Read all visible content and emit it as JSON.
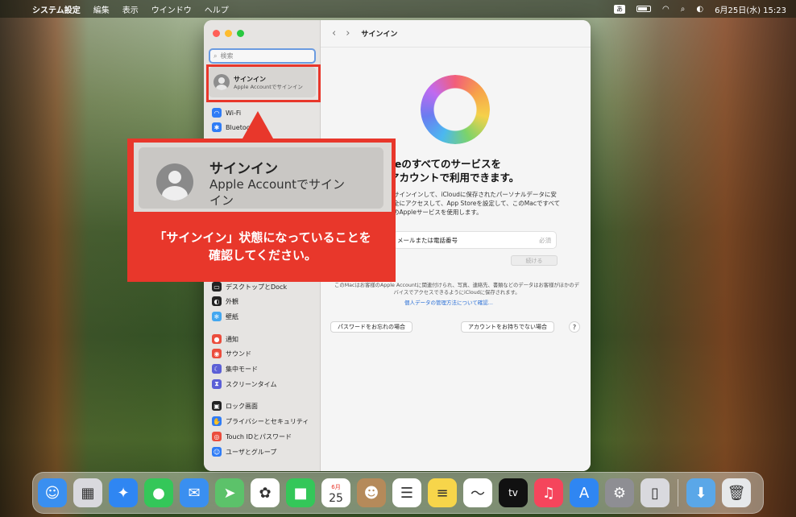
{
  "menubar": {
    "apple": "",
    "items": [
      "システム設定",
      "編集",
      "表示",
      "ウインドウ",
      "ヘルプ"
    ],
    "ime": "あ",
    "datetime": "6月25日(水)  15:23"
  },
  "window": {
    "search_placeholder": "検索",
    "signin_title": "サインイン",
    "signin_sub": "Apple Accountでサインイン",
    "sidebar_items": [
      {
        "label": "Wi-Fi",
        "icon": "wifi-icon",
        "color": "#2f7cf6"
      },
      {
        "label": "Bluetooth",
        "icon": "bluetooth-icon",
        "color": "#2f7cf6"
      },
      {
        "label": "デスクトップとDock",
        "icon": "dock-icon",
        "color": "#222222"
      },
      {
        "label": "外観",
        "icon": "appearance-icon",
        "color": "#222222"
      },
      {
        "label": "壁紙",
        "icon": "wallpaper-icon",
        "color": "#43a7f0"
      },
      {
        "label": "通知",
        "icon": "notification-icon",
        "color": "#eb4d3d"
      },
      {
        "label": "サウンド",
        "icon": "sound-icon",
        "color": "#eb4d3d"
      },
      {
        "label": "集中モード",
        "icon": "focus-icon",
        "color": "#5b5fd6"
      },
      {
        "label": "スクリーンタイム",
        "icon": "screentime-icon",
        "color": "#5b5fd6"
      },
      {
        "label": "ロック画面",
        "icon": "lock-icon",
        "color": "#222222"
      },
      {
        "label": "プライバシーとセキュリティ",
        "icon": "privacy-icon",
        "color": "#2f7cf6"
      },
      {
        "label": "Touch IDとパスワード",
        "icon": "touchid-icon",
        "color": "#eb4d3d"
      },
      {
        "label": "ユーザとグループ",
        "icon": "users-icon",
        "color": "#2f7cf6"
      }
    ],
    "toolbar_title": "サインイン",
    "headline": "Appleのすべてのサービスを\nこのアカウントで利用できます。",
    "description": "サインインして、iCloudに保存されたパーソナルデータに安全にアクセスして、App Storeを設定して、このMacですべてのAppleサービスを使用します。",
    "field_label": "メールまたは電話番号",
    "field_required": "必須",
    "continue": "続ける",
    "privacy_text": "このMacはお客様のApple Accountに関連付けられ、写真、連絡先、書類などのデータはお客様がほかのデバイスでアクセスできるようにiCloudに保存されます。",
    "privacy_link": "個人データの管理方法について確認...",
    "forgot_button": "パスワードをお忘れの場合",
    "noaccount_button": "アカウントをお持ちでない場合",
    "help": "?"
  },
  "callout": {
    "zoom_title": "サインイン",
    "zoom_sub": "Apple Accountでサイン\nイン",
    "message": "「サインイン」状態になっていることを\n確認してください。"
  },
  "dock": [
    {
      "name": "finder-icon",
      "glyph": "☺",
      "bg": "#3a8ff0"
    },
    {
      "name": "launchpad-icon",
      "glyph": "▦",
      "bg": "#d9d9de"
    },
    {
      "name": "safari-icon",
      "glyph": "✦",
      "bg": "#2f86f2"
    },
    {
      "name": "messages-icon",
      "glyph": "●",
      "bg": "#34c759"
    },
    {
      "name": "mail-icon",
      "glyph": "✉",
      "bg": "#3a8ff0"
    },
    {
      "name": "maps-icon",
      "glyph": "➤",
      "bg": "#5cc26a"
    },
    {
      "name": "photos-icon",
      "glyph": "✿",
      "bg": "#ffffff"
    },
    {
      "name": "facetime-icon",
      "glyph": "■",
      "bg": "#34c759"
    },
    {
      "name": "calendar-icon",
      "glyph": "25",
      "bg": "#ffffff"
    },
    {
      "name": "contacts-icon",
      "glyph": "☻",
      "bg": "#b58a5a"
    },
    {
      "name": "reminders-icon",
      "glyph": "☰",
      "bg": "#ffffff"
    },
    {
      "name": "notes-icon",
      "glyph": "≡",
      "bg": "#f7d54a"
    },
    {
      "name": "freeform-icon",
      "glyph": "～",
      "bg": "#ffffff"
    },
    {
      "name": "tv-icon",
      "glyph": "tv",
      "bg": "#111111"
    },
    {
      "name": "music-icon",
      "glyph": "♫",
      "bg": "#f5455c"
    },
    {
      "name": "appstore-icon",
      "glyph": "A",
      "bg": "#2f86f2"
    },
    {
      "name": "system-settings-icon",
      "glyph": "⚙",
      "bg": "#8e8e93"
    },
    {
      "name": "iphone-mirroring-icon",
      "glyph": "▯",
      "bg": "#d9d9de"
    },
    {
      "name": "downloads-icon",
      "glyph": "⬇",
      "bg": "#5aa7e8"
    },
    {
      "name": "trash-icon",
      "glyph": "🗑",
      "bg": "#e6e8ea"
    }
  ],
  "calendar_month": "6月"
}
